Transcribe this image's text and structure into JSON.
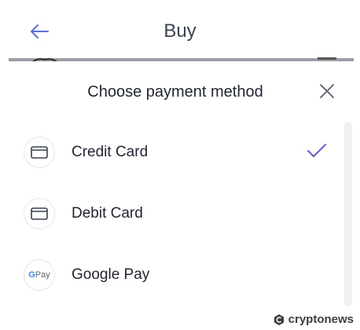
{
  "header": {
    "title": "Buy"
  },
  "sheet": {
    "title": "Choose payment method"
  },
  "payment_methods": [
    {
      "label": "Credit Card",
      "icon": "credit-card-icon",
      "selected": true
    },
    {
      "label": "Debit Card",
      "icon": "debit-card-icon",
      "selected": false
    },
    {
      "label": "Google Pay",
      "icon": "google-pay-icon",
      "selected": false
    }
  ],
  "google_pay_mark": {
    "g": "G",
    "pay": "Pay"
  },
  "watermark": {
    "text": "cryptonews"
  },
  "colors": {
    "accent": "#6c63c8",
    "text": "#1f2430",
    "icon": "#3a4150"
  }
}
